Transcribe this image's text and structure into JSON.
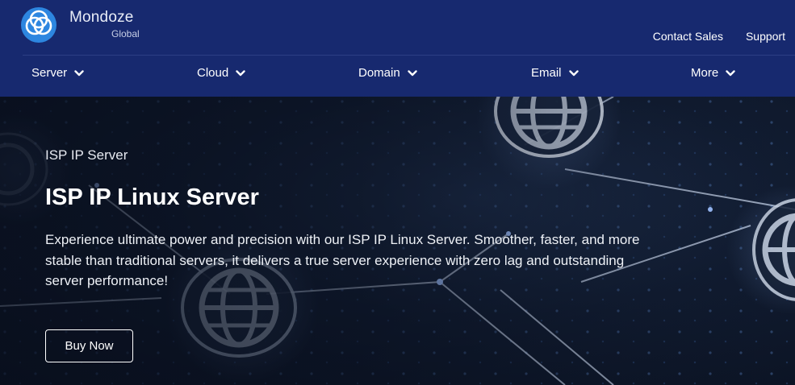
{
  "brand": {
    "name": "Mondoze",
    "tagline": "Global",
    "logo_icon": "interlocking-rings-logo"
  },
  "top_links": [
    {
      "label": "Contact Sales"
    },
    {
      "label": "Support"
    }
  ],
  "nav": {
    "items": [
      {
        "label": "Server",
        "icon": "chevron-down-icon"
      },
      {
        "label": "Cloud",
        "icon": "chevron-down-icon"
      },
      {
        "label": "Domain",
        "icon": "chevron-down-icon"
      },
      {
        "label": "Email",
        "icon": "chevron-down-icon"
      },
      {
        "label": "More",
        "icon": "chevron-down-icon"
      }
    ]
  },
  "hero": {
    "eyebrow": "ISP IP Server",
    "title": "ISP IP Linux Server",
    "description": "Experience ultimate power and precision with our ISP IP Linux Server. Smoother, faster, and more stable than traditional servers, it delivers a true server experience with zero lag and outstanding server performance!",
    "cta_label": "Buy Now",
    "background": "network-globe-icons"
  },
  "colors": {
    "header_bg": "#17296f",
    "logo_blue": "#2d86e0",
    "hero_bg": "#111c31",
    "text": "#ffffff"
  }
}
